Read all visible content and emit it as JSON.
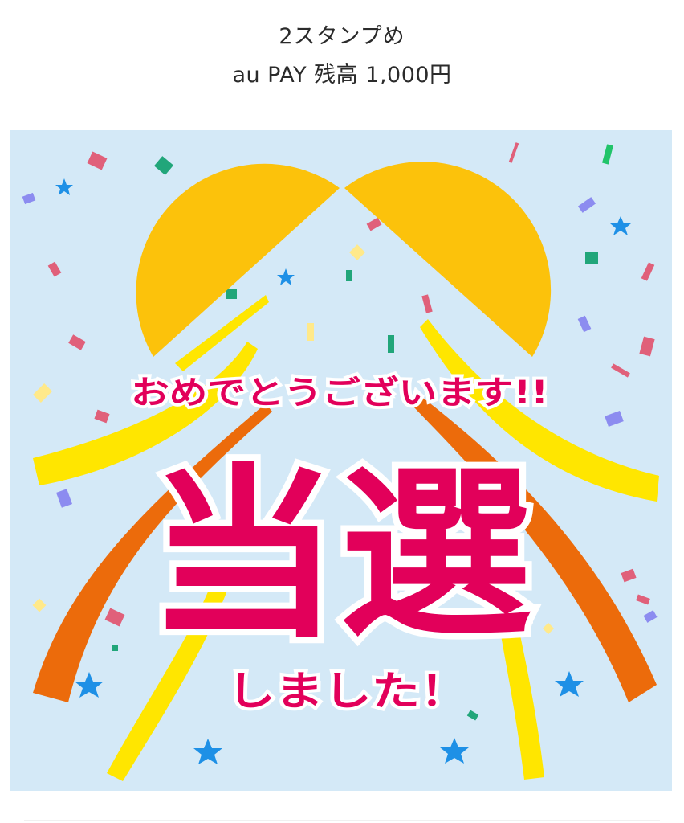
{
  "header": {
    "stamp_label": "2スタンプめ",
    "balance_label": "au PAY 残高 1,000円"
  },
  "banner": {
    "congrats_text": "おめでとうございます!!",
    "win_text": "当選",
    "done_text": "しました！",
    "colors": {
      "background": "#d4e9f7",
      "fan": "#fcc20b",
      "yellow_ribbon": "#ffe600",
      "orange_ribbon": "#ec6b0b",
      "main_text": "#e2005a",
      "text_outline": "#ffffff",
      "star": "#1e90e6"
    }
  }
}
